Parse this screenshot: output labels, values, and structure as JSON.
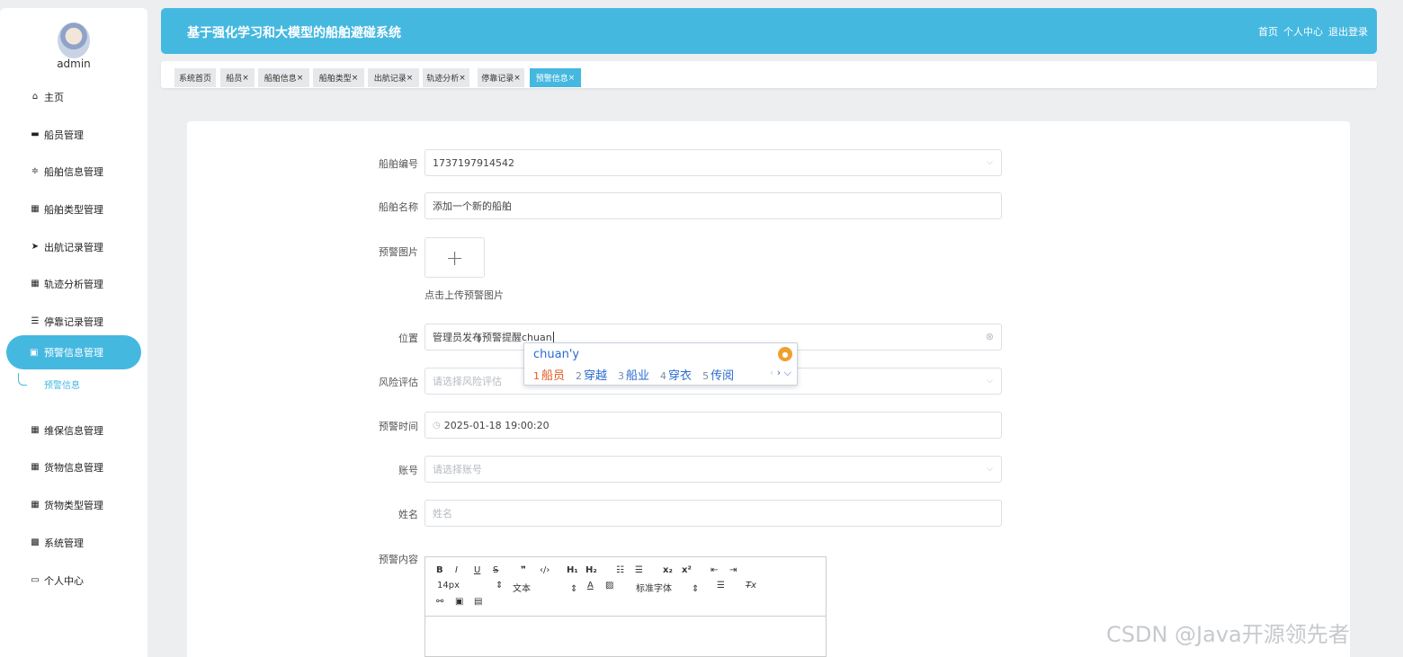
{
  "header": {
    "title": "基于强化学习和大模型的船舶避碰系统",
    "links": [
      "首页",
      "个人中心",
      "退出登录"
    ]
  },
  "user": {
    "name": "admin"
  },
  "sidebar": {
    "items": [
      {
        "label": "主页",
        "icon": "home-icon"
      },
      {
        "label": "船员管理",
        "icon": "monitor-icon"
      },
      {
        "label": "船舶信息管理",
        "icon": "sliders-icon"
      },
      {
        "label": "船舶类型管理",
        "icon": "grid-icon"
      },
      {
        "label": "出航记录管理",
        "icon": "send-icon"
      },
      {
        "label": "轨迹分析管理",
        "icon": "grid-icon"
      },
      {
        "label": "停靠记录管理",
        "icon": "list-icon"
      },
      {
        "label": "预警信息管理",
        "icon": "clipboard-icon"
      },
      {
        "label": "维保信息管理",
        "icon": "grid-icon"
      },
      {
        "label": "货物信息管理",
        "icon": "grid-icon"
      },
      {
        "label": "货物类型管理",
        "icon": "grid-icon"
      },
      {
        "label": "系统管理",
        "icon": "apps-icon"
      },
      {
        "label": "个人中心",
        "icon": "calendar-icon"
      }
    ],
    "sub_item": "预警信息"
  },
  "tabs": [
    "系统首页",
    "船员",
    "船舶信息",
    "船舶类型",
    "出航记录",
    "轨迹分析",
    "停靠记录",
    "预警信息"
  ],
  "form": {
    "ship_no": {
      "label": "船舶编号",
      "value": "1737197914542"
    },
    "ship_name": {
      "label": "船舶名称",
      "value": "添加一个新的船舶"
    },
    "image": {
      "label": "预警图片",
      "hint": "点击上传预警图片"
    },
    "location": {
      "label": "位置",
      "value": "管理员发布预警提醒chuan"
    },
    "risk": {
      "label": "风险评估",
      "placeholder": "请选择风险评估"
    },
    "time": {
      "label": "预警时间",
      "value": "2025-01-18 19:00:20"
    },
    "account": {
      "label": "账号",
      "placeholder": "请选择账号"
    },
    "name": {
      "label": "姓名",
      "placeholder": "姓名"
    },
    "content": {
      "label": "预警内容"
    }
  },
  "ime": {
    "input": "chuan'y",
    "candidates": [
      {
        "n": "1",
        "text": "船员"
      },
      {
        "n": "2",
        "text": "穿越"
      },
      {
        "n": "3",
        "text": "船业"
      },
      {
        "n": "4",
        "text": "穿衣"
      },
      {
        "n": "5",
        "text": "传阅"
      }
    ]
  },
  "editor": {
    "font_size": "14px",
    "text_type": "文本",
    "font_family": "标准字体"
  },
  "watermark": "CSDN @Java开源领先者"
}
